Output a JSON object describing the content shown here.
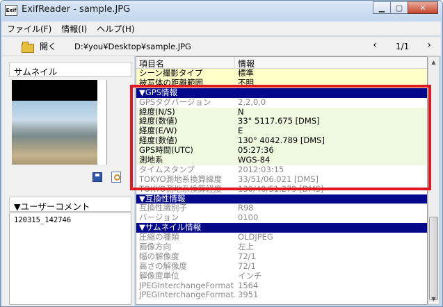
{
  "window": {
    "title": "ExifReader - sample.JPG",
    "icon_text": "Exif"
  },
  "menu": [
    "ファイル(F)",
    "情報(I)",
    "ヘルプ(H)"
  ],
  "toolbar": {
    "open_label": "開く",
    "path": "D:¥you¥Desktop¥sample.JPG",
    "page": "1/1",
    "prev": "‹",
    "next": "›"
  },
  "left": {
    "thumbnail_label": "サムネイル",
    "comment_label": "▼ユーザーコメント",
    "comment_value": "120315_142746"
  },
  "table": {
    "col_item": "項目名",
    "col_info": "情報",
    "rows": [
      {
        "k": "シーン撮影タイプ",
        "v": "標準",
        "style": "yellow"
      },
      {
        "k": "被写体の距離範囲",
        "v": "不明",
        "style": "yellow"
      },
      {
        "k": "▼GPS情報",
        "v": "",
        "style": "header"
      },
      {
        "k": "GPSタグバージョン",
        "v": "2,2,0,0",
        "style": "grey"
      },
      {
        "k": "緯度(N/S)",
        "v": "N",
        "style": "green"
      },
      {
        "k": "緯度(数値)",
        "v": "33° 5117.675 [DMS]",
        "style": "green"
      },
      {
        "k": "経度(E/W)",
        "v": "E",
        "style": "green"
      },
      {
        "k": "経度(数値)",
        "v": "130° 4042.789 [DMS]",
        "style": "green"
      },
      {
        "k": "GPS時間(UTC)",
        "v": "05:27:36",
        "style": "green"
      },
      {
        "k": "測地系",
        "v": "WGS-84",
        "style": "green"
      },
      {
        "k": "タイムスタンプ",
        "v": "2012:03:15",
        "style": "grey"
      },
      {
        "k": "TOKYO測地系換算緯度",
        "v": "33/51/06.021 [DMS]",
        "style": "grey"
      },
      {
        "k": "TOKYO測地系換算経度",
        "v": "130/40/51.279 [DMS]",
        "style": "grey"
      },
      {
        "k": "▼互換性情報",
        "v": "",
        "style": "header"
      },
      {
        "k": "互換性識別子",
        "v": "R98",
        "style": "grey"
      },
      {
        "k": "バージョン",
        "v": "0100",
        "style": "grey"
      },
      {
        "k": "▼サムネイル情報",
        "v": "",
        "style": "header"
      },
      {
        "k": "圧縮の種類",
        "v": "OLDJPEG",
        "style": "grey"
      },
      {
        "k": "画像方向",
        "v": "左上",
        "style": "grey"
      },
      {
        "k": "幅の解像度",
        "v": "72/1",
        "style": "grey"
      },
      {
        "k": "高さの解像度",
        "v": "72/1",
        "style": "grey"
      },
      {
        "k": "解像度単位",
        "v": "インチ",
        "style": "grey"
      },
      {
        "k": "JPEGInterchangeFormat",
        "v": "1564",
        "style": "grey"
      },
      {
        "k": "JPEGInterchangeFormat...",
        "v": "3951",
        "style": "grey"
      }
    ]
  },
  "colors": {
    "header_bg": "#04098c",
    "highlight": "#e01822",
    "yellow_row": "#ffffc8",
    "green_row": "#eef9df"
  }
}
